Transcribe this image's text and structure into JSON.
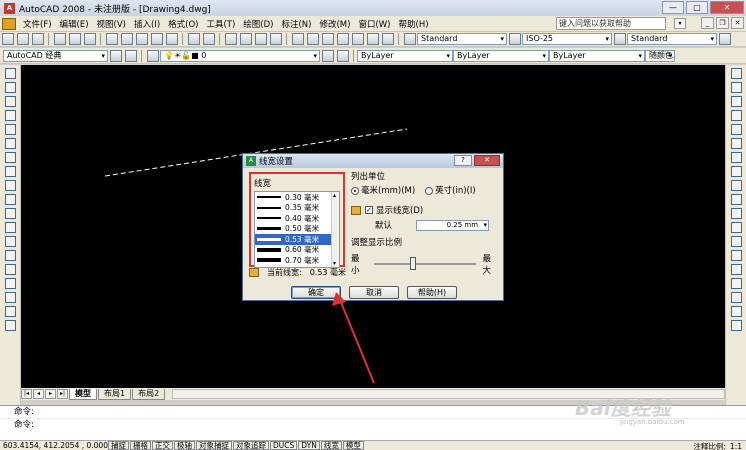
{
  "window": {
    "title": "AutoCAD 2008 - 未注册版 - [Drawing4.dwg]"
  },
  "menu": {
    "items": [
      "文件(F)",
      "编辑(E)",
      "视图(V)",
      "插入(I)",
      "格式(O)",
      "工具(T)",
      "绘图(D)",
      "标注(N)",
      "修改(M)",
      "窗口(W)",
      "帮助(H)"
    ],
    "help_search_placeholder": "键入问题以获取帮助"
  },
  "toolbar1": {
    "text_style": "Standard",
    "dim_style": "ISO-25",
    "table_style": "Standard"
  },
  "toolbar2": {
    "workspace": "AutoCAD 经典",
    "layer": "0",
    "color": "ByLayer",
    "linetype": "ByLayer",
    "lineweight": "ByLayer",
    "plot_style": "随颜色"
  },
  "tabs": [
    "模型",
    "布局1",
    "布局2"
  ],
  "command": {
    "line1": "命令:",
    "line2": "命令:"
  },
  "status": {
    "coords": "603.4154,  412.2054 , 0.0000",
    "buttons": [
      "捕捉",
      "栅格",
      "正交",
      "极轴",
      "对象捕捉",
      "对象追踪",
      "DUCS",
      "DYN",
      "线宽",
      "模型"
    ],
    "annotation_scale_label": "注释比例:",
    "annotation_scale_value": "1:1"
  },
  "dialog": {
    "title": "线宽设置",
    "lineweights_label": "线宽",
    "lineweights": [
      {
        "label": "0.30 毫米",
        "mm": 0.3
      },
      {
        "label": "0.35 毫米",
        "mm": 0.35
      },
      {
        "label": "0.40 毫米",
        "mm": 0.4
      },
      {
        "label": "0.50 毫米",
        "mm": 0.5
      },
      {
        "label": "0.53 毫米",
        "mm": 0.53
      },
      {
        "label": "0.60 毫米",
        "mm": 0.6
      },
      {
        "label": "0.70 毫米",
        "mm": 0.7
      }
    ],
    "selected_index": 4,
    "units_label": "列出单位",
    "unit_mm": "毫米(mm)(M)",
    "unit_in": "英寸(in)(I)",
    "display_lineweight": "显示线宽(D)",
    "default_label": "默认",
    "default_value": "0.25 mm",
    "adjust_scale_label": "调整显示比例",
    "min_label": "最小",
    "max_label": "最大",
    "current_label": "当前线宽:",
    "current_value": "0.53 毫米",
    "ok": "确定",
    "cancel": "取消",
    "help": "帮助(H)"
  },
  "watermark": {
    "brand": "Bai度经验",
    "url": "jingyan.baidu.com"
  }
}
